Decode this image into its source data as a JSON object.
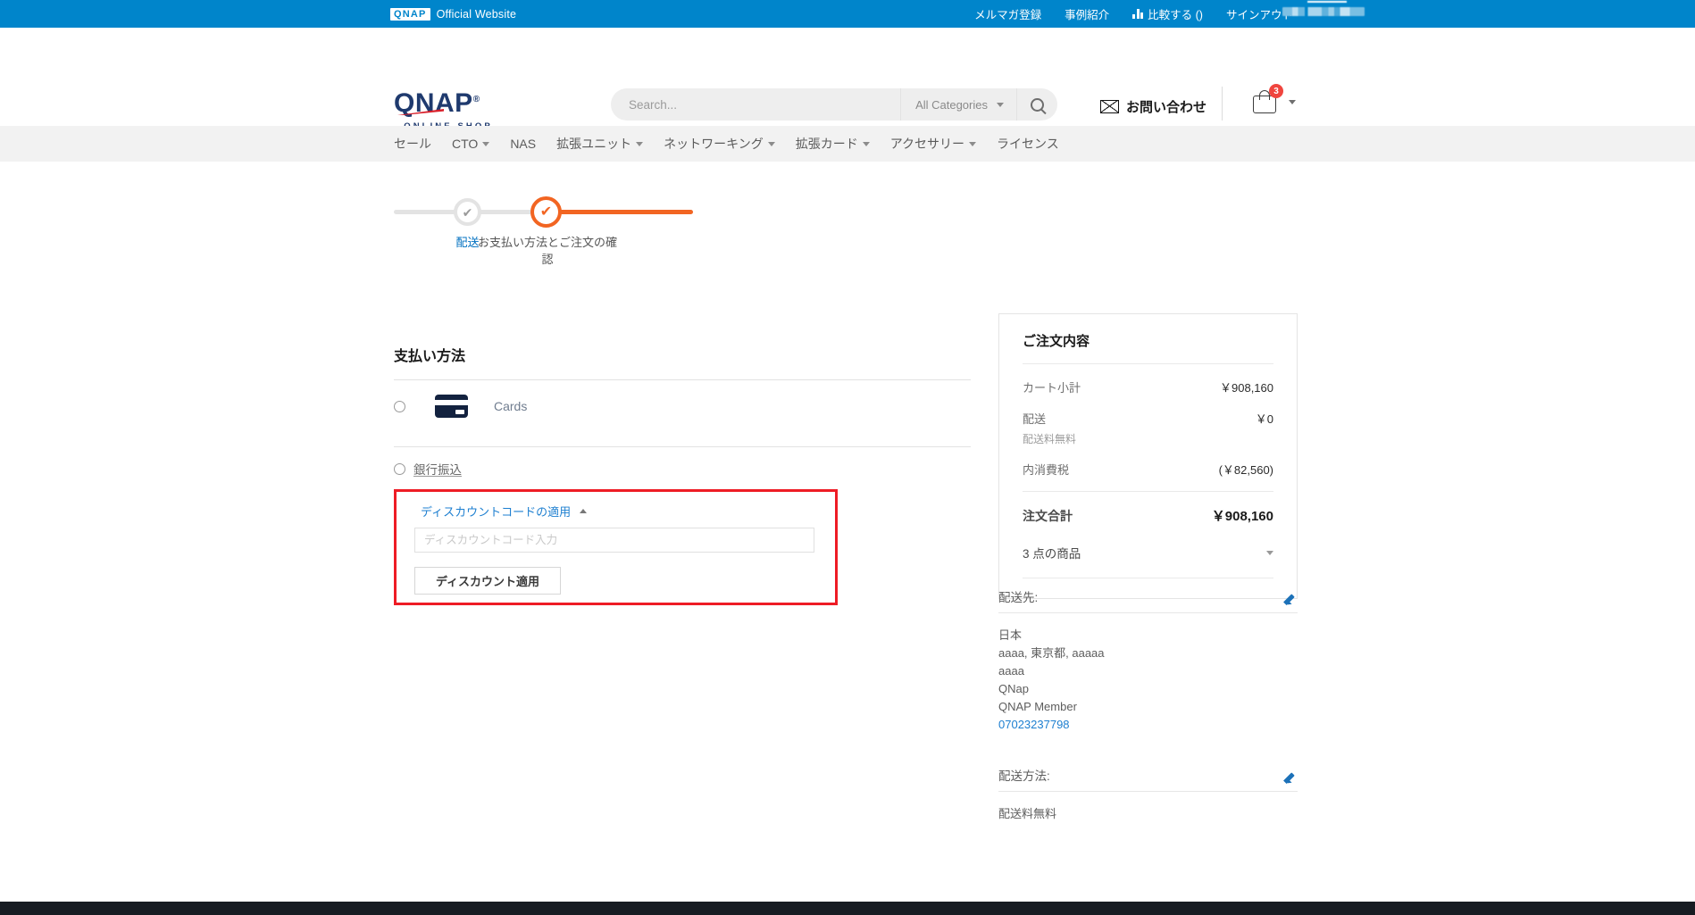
{
  "topbar": {
    "brand_mark": "QNAP",
    "brand_sup": "®",
    "official_label": "Official Website",
    "links": [
      {
        "label": "メルマガ登録",
        "icon": "none"
      },
      {
        "label": "事例紹介",
        "icon": "none"
      },
      {
        "label": "比較する ()",
        "icon": "bar-chart-icon"
      },
      {
        "label": "サインアウト",
        "icon": "none"
      }
    ],
    "account_redacted": true
  },
  "header": {
    "logo_main": "QNAP",
    "logo_reg": "®",
    "logo_sub": "ONLINE SHOP JP",
    "search": {
      "placeholder": "Search...",
      "value": "",
      "category_selected": "All Categories",
      "search_icon": "magnifier-icon"
    },
    "contact_label": "お問い合わせ",
    "contact_icon": "envelope-icon",
    "cart_icon": "shopping-bag-icon",
    "cart_count": "3"
  },
  "nav": {
    "items": [
      {
        "label": "セール",
        "has_dropdown": false
      },
      {
        "label": "CTO",
        "has_dropdown": true
      },
      {
        "label": "NAS",
        "has_dropdown": false
      },
      {
        "label": "拡張ユニット",
        "has_dropdown": true
      },
      {
        "label": "ネットワーキング",
        "has_dropdown": true
      },
      {
        "label": "拡張カード",
        "has_dropdown": true
      },
      {
        "label": "アクセサリー",
        "has_dropdown": true
      },
      {
        "label": "ライセンス",
        "has_dropdown": false
      }
    ]
  },
  "stepper": {
    "steps": [
      {
        "label": "配送",
        "state": "done"
      },
      {
        "label": "お支払い方法とご注文の確認",
        "state": "current"
      }
    ],
    "check_glyph": "✔",
    "active_color": "#f26522",
    "inactive_color": "#e3e3e3"
  },
  "payment": {
    "title": "支払い方法",
    "methods": [
      {
        "label": "Cards",
        "icon": "credit-card-icon",
        "selected": false
      },
      {
        "label": "銀行振込",
        "icon": "none",
        "selected": false
      }
    ]
  },
  "discount": {
    "toggle_label": "ディスカウントコードの適用",
    "toggle_icon": "chevron-up-icon",
    "input_placeholder": "ディスカウントコード入力",
    "input_value": "",
    "apply_label": "ディスカウント適用",
    "highlight_color": "#ee1c25"
  },
  "summary": {
    "title": "ご注文内容",
    "rows": [
      {
        "label": "カート小計",
        "value": "￥908,160",
        "note": ""
      },
      {
        "label": "配送",
        "value": "￥0",
        "note": "配送料無料"
      },
      {
        "label": "内消費税",
        "value": "(￥82,560)",
        "note": ""
      }
    ],
    "total_label": "注文合計",
    "total_value": "￥908,160",
    "items_label": "3 点の商品",
    "items_icon": "chevron-down-icon"
  },
  "shipping_address": {
    "heading": "配送先:",
    "edit_icon": "pencil-icon",
    "lines": [
      "日本",
      "aaaa, 東京都, aaaaa",
      "aaaa",
      "QNap",
      "QNAP Member"
    ],
    "phone": "07023237798"
  },
  "shipping_method": {
    "heading": "配送方法:",
    "edit_icon": "pencil-icon",
    "value": "配送料無料"
  }
}
